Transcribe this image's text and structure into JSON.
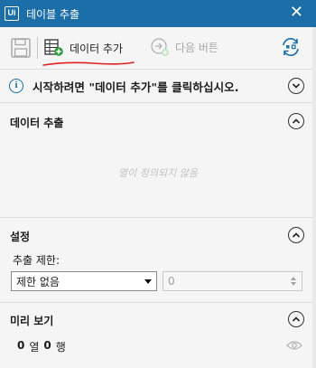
{
  "window": {
    "logo_text": "Ui",
    "title": "테이블 추출",
    "close_glyph": "✕"
  },
  "toolbar": {
    "save_icon": "save-icon",
    "add_data_label": "데이터 추가",
    "add_data_icon": "add-table-icon",
    "next_label": "다음 버튼",
    "next_icon": "next-icon",
    "refresh_icon": "refresh-icon"
  },
  "info": {
    "icon_glyph": "i",
    "message": "시작하려면 \"데이터 추가\"를 클릭하십시오."
  },
  "data_section": {
    "title": "데이터 추출",
    "empty_message": "열이 정의되지 않음"
  },
  "settings": {
    "title": "설정",
    "limit_label": "추출 제한:",
    "limit_value": "제한 없음",
    "count_value": "0"
  },
  "preview": {
    "title": "미리 보기",
    "columns": "0",
    "columns_unit": "열",
    "rows": "0",
    "rows_unit": "행"
  },
  "colors": {
    "titlebar": "#1b6ea8",
    "accent": "#1b6ea8",
    "annotation_red": "#e02020",
    "disabled": "#a8a8a8"
  }
}
